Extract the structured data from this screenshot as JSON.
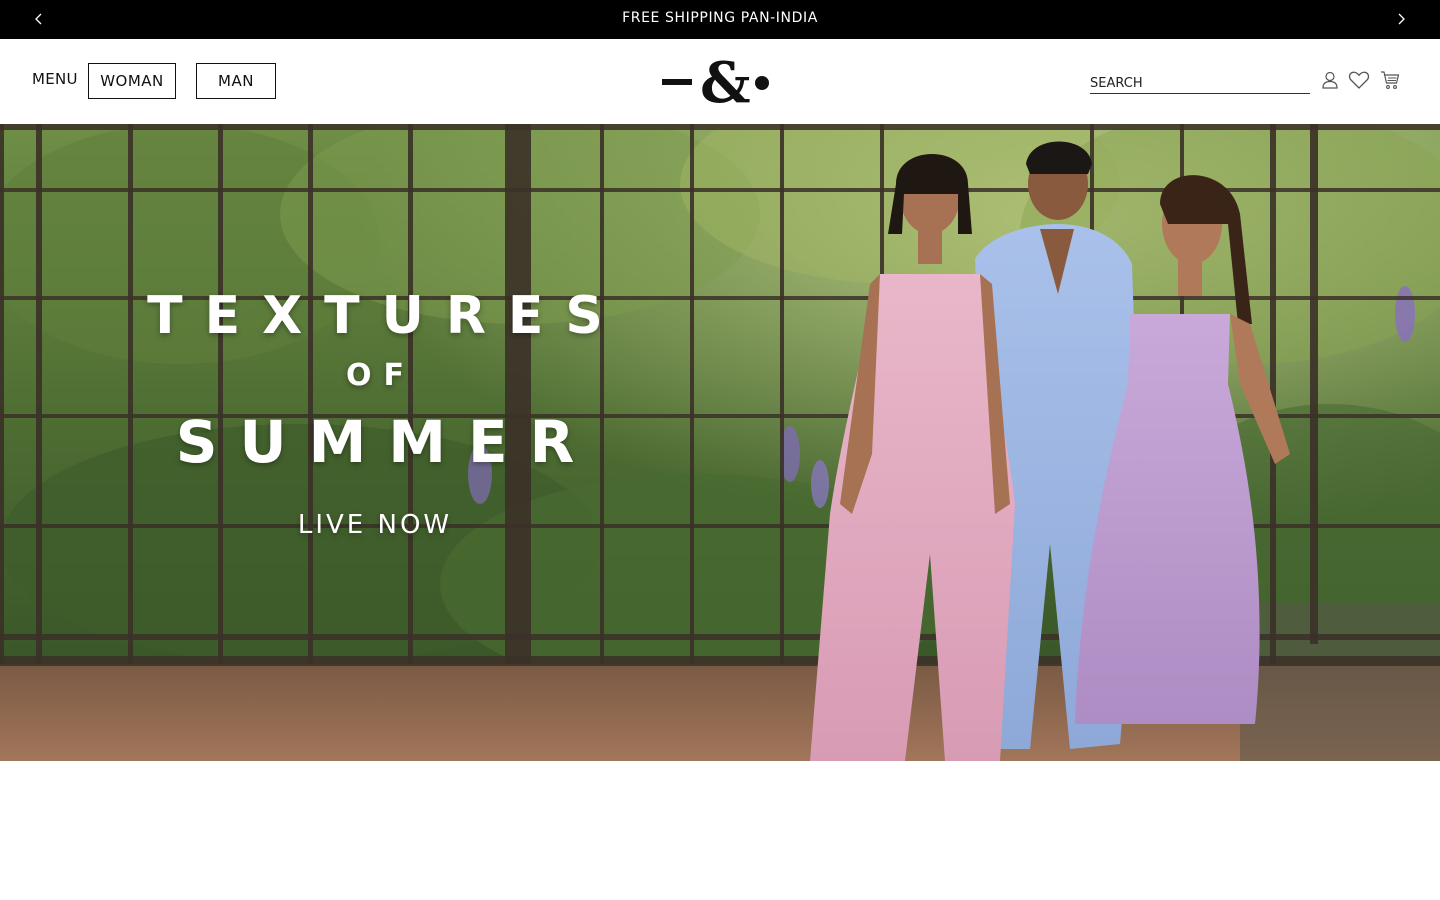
{
  "announcement": {
    "text": "FREE SHIPPING PAN-INDIA",
    "prev_icon": "chevron-left-icon",
    "next_icon": "chevron-right-icon"
  },
  "header": {
    "menu_label": "MENU",
    "woman_label": "WOMAN",
    "man_label": "MAN",
    "logo_alt": "-&.",
    "search_placeholder": "SEARCH",
    "icons": [
      "user-icon",
      "heart-icon",
      "cart-icon"
    ]
  },
  "hero": {
    "title_line1": "TEXTURES",
    "title_line2": "OF",
    "title_line3": "SUMMER",
    "cta": "LIVE NOW"
  },
  "colors": {
    "announcement_bg": "#000000",
    "text": "#111111",
    "page_bg": "#ffffff"
  }
}
